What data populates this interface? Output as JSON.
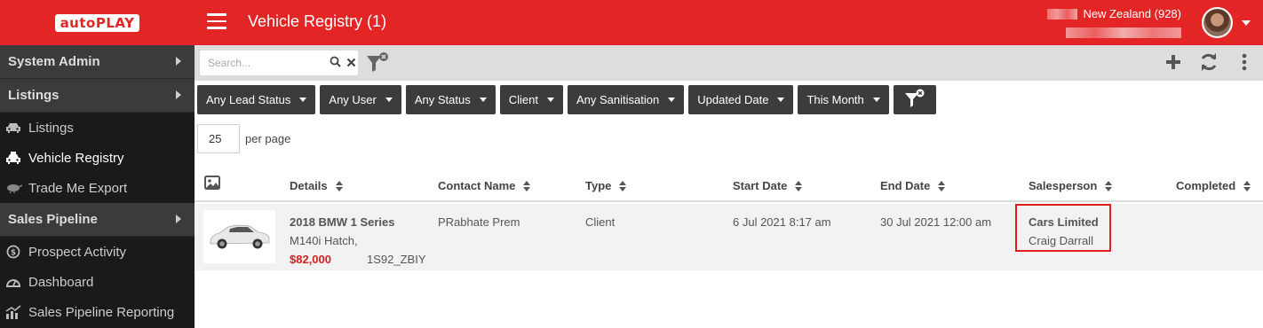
{
  "header": {
    "logo_text": "autoPLAY",
    "title": "Vehicle Registry (1)",
    "account_region": "New Zealand (928)"
  },
  "sidebar": {
    "sections": [
      {
        "label": "System Admin"
      },
      {
        "label": "Listings"
      },
      {
        "label": "Sales Pipeline"
      }
    ],
    "items": [
      {
        "label": "Listings",
        "icon": "car-icon"
      },
      {
        "label": "Vehicle Registry",
        "icon": "taxi-icon"
      },
      {
        "label": "Trade Me Export",
        "icon": "kiwi-icon"
      },
      {
        "label": "Prospect Activity",
        "icon": "dollar-circle-icon"
      },
      {
        "label": "Dashboard",
        "icon": "gauge-icon"
      },
      {
        "label": "Sales Pipeline Reporting",
        "icon": "chart-icon"
      }
    ]
  },
  "toolbar": {
    "search_placeholder": "Search...",
    "right_buttons": [
      "plus-icon",
      "refresh-icon",
      "more-vertical-icon"
    ]
  },
  "filters": [
    {
      "label": "Any Lead Status"
    },
    {
      "label": "Any User"
    },
    {
      "label": "Any Status"
    },
    {
      "label": "Client"
    },
    {
      "label": "Any Sanitisation"
    },
    {
      "label": "Updated Date"
    },
    {
      "label": "This Month"
    }
  ],
  "pagination": {
    "per_page_value": "25",
    "per_page_label": "per page"
  },
  "table": {
    "columns": [
      "Details",
      "Contact Name",
      "Type",
      "Start Date",
      "End Date",
      "Salesperson",
      "Completed"
    ],
    "rows": [
      {
        "title": "2018 BMW 1 Series",
        "subtitle": "M140i Hatch,",
        "price": "$82,000",
        "stock": "1S92_ZBIY",
        "contact": "PRabhate Prem",
        "type": "Client",
        "start": "6 Jul 2021 8:17 am",
        "end": "30 Jul 2021 12:00 am",
        "salesperson_company": "Cars Limited",
        "salesperson_name": "Craig Darrall",
        "completed": ""
      }
    ]
  },
  "colors": {
    "brand_red": "#e42525",
    "sidebar_bg": "#1a1a1a",
    "filter_bg": "#3c3c3c",
    "price_red": "#d32020"
  }
}
